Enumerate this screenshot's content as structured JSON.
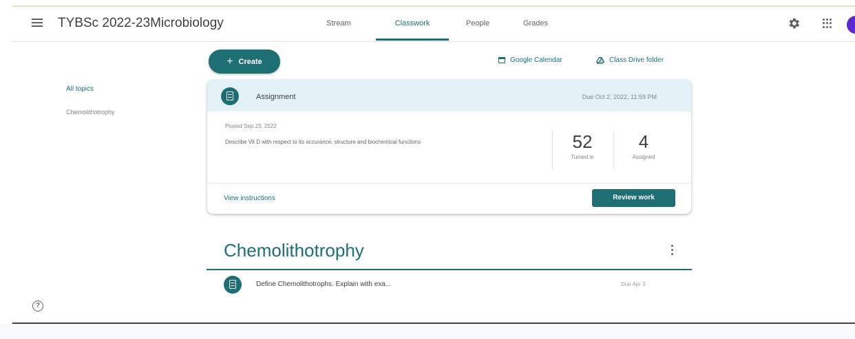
{
  "header": {
    "class_title": "TYBSc 2022-23Microbiology",
    "tabs": [
      {
        "label": "Stream",
        "active": false
      },
      {
        "label": "Classwork",
        "active": true
      },
      {
        "label": "People",
        "active": false
      },
      {
        "label": "Grades",
        "active": false
      }
    ],
    "icons": [
      "menu-icon",
      "gear-icon",
      "apps-icon"
    ]
  },
  "sidebar": {
    "items": [
      {
        "label": "All topics",
        "active": true
      },
      {
        "label": "Chemolithotrophy",
        "active": false
      }
    ]
  },
  "toolbar": {
    "create_label": "Create",
    "google_calendar_label": "Google Calendar",
    "class_drive_label": "Class Drive folder"
  },
  "assignment_card": {
    "type_label": "Assignment",
    "due": "Due Oct 2, 2022, 11:59 PM",
    "posted": "Posted Sep 23, 2022",
    "description": "Describe Vit D with respect to its occurance, structure and biochemical functions",
    "turned_in_count": "52",
    "turned_in_label": "Turned in",
    "assigned_count": "4",
    "assigned_label": "Assigned",
    "view_instructions_label": "View instructions",
    "review_work_label": "Review work"
  },
  "topic": {
    "title": "Chemolithotrophy",
    "items": [
      {
        "title": "Define Chemolithotrophs. Explain with exa...",
        "due": "Due Apr 3"
      }
    ]
  },
  "colors": {
    "accent": "#1e6f73",
    "card_header_bg": "#e3f2f6",
    "avatar": "#5b2bd1"
  }
}
